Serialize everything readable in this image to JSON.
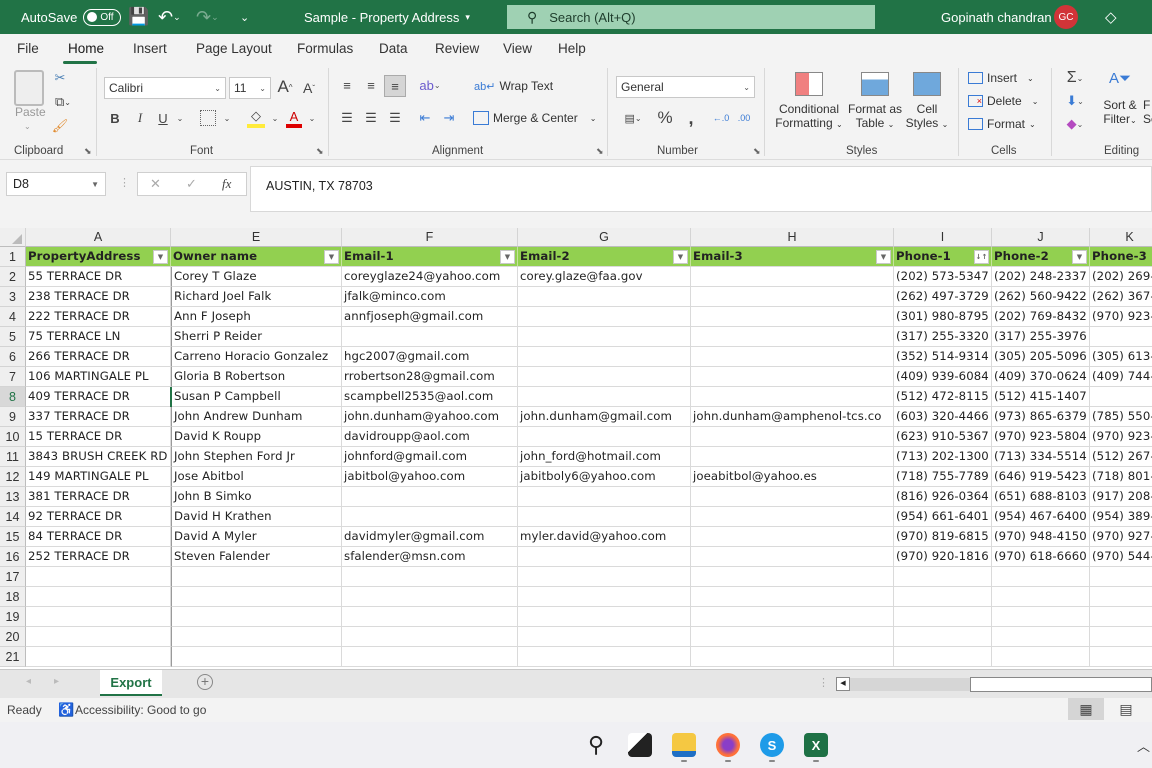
{
  "titlebar": {
    "autosave_label": "AutoSave",
    "autosave_state": "Off",
    "document_title": "Sample - Property Address",
    "search_placeholder": "Search (Alt+Q)",
    "user_name": "Gopinath chandran",
    "user_initials": "GC"
  },
  "menu": {
    "tabs": [
      "File",
      "Home",
      "Insert",
      "Page Layout",
      "Formulas",
      "Data",
      "Review",
      "View",
      "Help"
    ],
    "active": "Home"
  },
  "ribbon": {
    "clipboard": {
      "paste_label": "Paste",
      "group_label": "Clipboard"
    },
    "font": {
      "font_name": "Calibri",
      "font_size": "11",
      "bold": "B",
      "italic": "I",
      "underline": "U",
      "group_label": "Font"
    },
    "alignment": {
      "wrap_text": "Wrap Text",
      "merge_center": "Merge & Center",
      "group_label": "Alignment"
    },
    "number": {
      "format": "General",
      "group_label": "Number"
    },
    "styles": {
      "conditional_formatting": [
        "Conditional",
        "Formatting"
      ],
      "format_as_table": [
        "Format as",
        "Table"
      ],
      "cell_styles": [
        "Cell",
        "Styles"
      ],
      "group_label": "Styles"
    },
    "cells": {
      "insert": "Insert",
      "delete": "Delete",
      "format": "Format",
      "group_label": "Cells"
    },
    "editing": {
      "sort_filter": [
        "Sort &",
        "Filter"
      ],
      "find_select": [
        "F",
        "Se"
      ],
      "group_label": "Editing"
    }
  },
  "formula_bar": {
    "name_box": "D8",
    "cancel": "✕",
    "enter": "✓",
    "fx": "fx",
    "content": "AUSTIN, TX  78703"
  },
  "sheet": {
    "columns": [
      "A",
      "E",
      "F",
      "G",
      "H",
      "I",
      "J",
      "K"
    ],
    "headers": [
      "PropertyAddress",
      "Owner name",
      "Email-1",
      "Email-2",
      "Email-3",
      "Phone-1",
      "Phone-2",
      "Phone-3"
    ],
    "row_numbers": [
      "1",
      "2",
      "3",
      "4",
      "5",
      "6",
      "7",
      "8",
      "9",
      "10",
      "11",
      "12",
      "13",
      "14",
      "15",
      "16",
      "17",
      "18",
      "19",
      "20",
      "21"
    ],
    "rows": [
      [
        "55 TERRACE DR",
        "Corey T Glaze",
        "coreyglaze24@yahoo.com",
        "corey.glaze@faa.gov",
        "",
        "(202) 573-5347",
        "(202) 248-2337",
        "(202) 269-"
      ],
      [
        "238 TERRACE DR",
        "Richard Joel Falk",
        "jfalk@minco.com",
        "",
        "",
        "(262) 497-3729",
        "(262) 560-9422",
        "(262) 367-"
      ],
      [
        "222 TERRACE DR",
        "Ann F Joseph",
        "annfjoseph@gmail.com",
        "",
        "",
        "(301) 980-8795",
        "(202) 769-8432",
        "(970) 923-"
      ],
      [
        "75 TERRACE LN",
        "Sherri P Reider",
        "",
        "",
        "",
        "(317) 255-3320",
        "(317) 255-3976",
        ""
      ],
      [
        "266 TERRACE DR",
        "Carreno Horacio Gonzalez",
        "hgc2007@gmail.com",
        "",
        "",
        "(352) 514-9314",
        "(305) 205-5096",
        "(305) 613-"
      ],
      [
        "106 MARTINGALE PL",
        "Gloria B Robertson",
        "rrobertson28@gmail.com",
        "",
        "",
        "(409) 939-6084",
        "(409) 370-0624",
        "(409) 744-"
      ],
      [
        "409 TERRACE DR",
        "Susan P Campbell",
        "scampbell2535@aol.com",
        "",
        "",
        "(512) 472-8115",
        "(512) 415-1407",
        ""
      ],
      [
        "337 TERRACE DR",
        "John Andrew Dunham",
        "john.dunham@yahoo.com",
        "john.dunham@gmail.com",
        "john.dunham@amphenol-tcs.co",
        "(603) 320-4466",
        "(973) 865-6379",
        "(785) 550-"
      ],
      [
        "15 TERRACE DR",
        "David K Roupp",
        "davidroupp@aol.com",
        "",
        "",
        "(623) 910-5367",
        "(970) 923-5804",
        "(970) 923-"
      ],
      [
        "3843 BRUSH CREEK RD",
        "John Stephen Ford Jr",
        "johnford@gmail.com",
        "john_ford@hotmail.com",
        "",
        "(713) 202-1300",
        "(713) 334-5514",
        "(512) 267-"
      ],
      [
        "149 MARTINGALE PL",
        "Jose Abitbol",
        "jabitbol@yahoo.com",
        "jabitboly6@yahoo.com",
        "joeabitbol@yahoo.es",
        "(718) 755-7789",
        "(646) 919-5423",
        "(718) 801-"
      ],
      [
        "381 TERRACE DR",
        "John B Simko",
        "",
        "",
        "",
        "(816) 926-0364",
        "(651) 688-8103",
        "(917) 208-"
      ],
      [
        "92 TERRACE DR",
        "David H Krathen",
        "",
        "",
        "",
        "(954) 661-6401",
        "(954) 467-6400",
        "(954) 389-"
      ],
      [
        "84 TERRACE DR",
        "David A Myler",
        "davidmyler@gmail.com",
        "myler.david@yahoo.com",
        "",
        "(970) 819-6815",
        "(970) 948-4150",
        "(970) 927-"
      ],
      [
        "252 TERRACE DR",
        "Steven Falender",
        "sfalender@msn.com",
        "",
        "",
        "(970) 920-1816",
        "(970) 618-6660",
        "(970) 544-"
      ]
    ],
    "empty_rows": 5
  },
  "sheet_tabs": {
    "tabs": [
      "Export"
    ],
    "active": "Export"
  },
  "status": {
    "ready": "Ready",
    "accessibility": "Accessibility: Good to go"
  },
  "taskbar": {
    "apps": [
      "Start",
      "Search",
      "Task View",
      "File Explorer",
      "Firefox",
      "Skype",
      "Excel"
    ]
  },
  "colors": {
    "accent": "#217346",
    "header_fill": "#92d050",
    "avatar": "#d13438"
  }
}
